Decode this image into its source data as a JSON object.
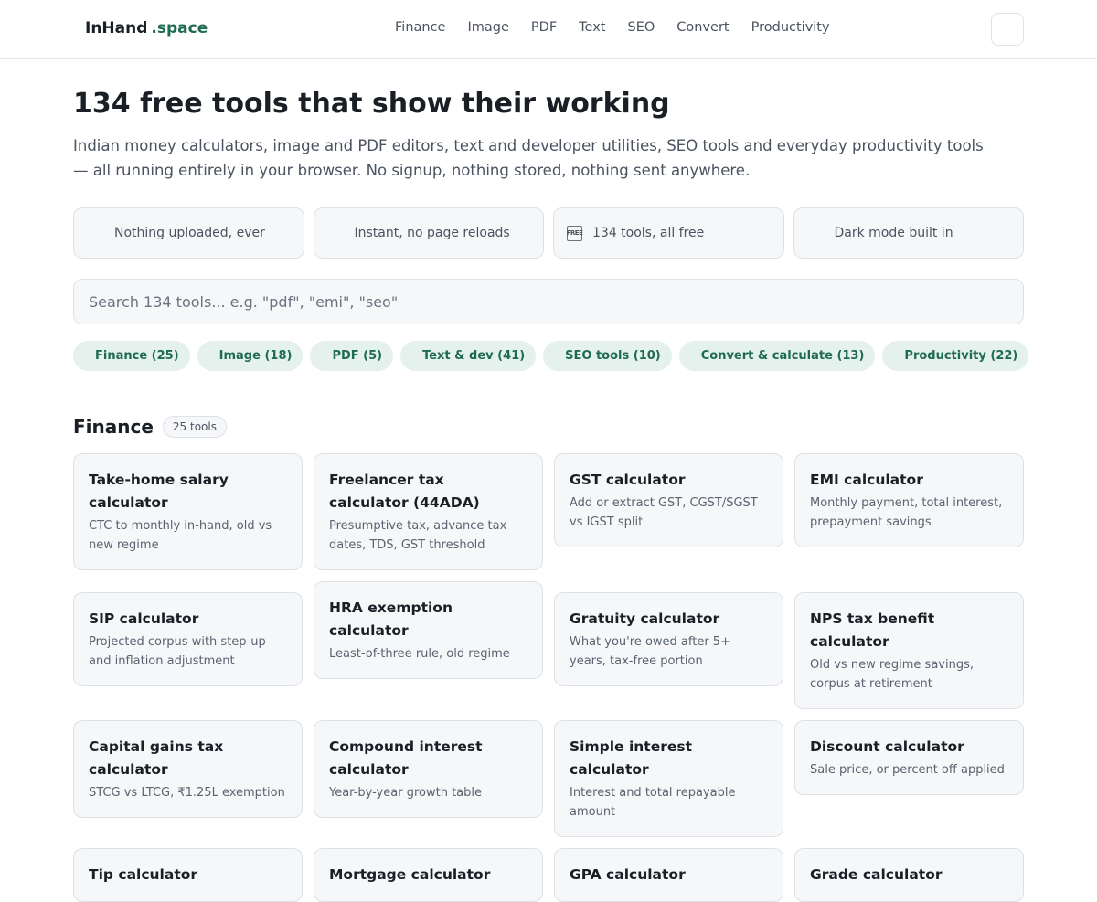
{
  "header": {
    "brand_main": "InHand",
    "brand_suffix": ".space",
    "nav": [
      "Finance",
      "Image",
      "PDF",
      "Text",
      "SEO",
      "Convert",
      "Productivity"
    ]
  },
  "hero": {
    "title": "134 free tools that show their working",
    "lede": "Indian money calculators, image and PDF editors, text and developer utilities, SEO tools and everyday productivity tools — all running entirely in your browser. No signup, nothing stored, nothing sent anywhere."
  },
  "features": [
    {
      "icon": "lock-icon",
      "label": "Nothing uploaded, ever"
    },
    {
      "icon": "lightning-icon",
      "label": "Instant, no page reloads"
    },
    {
      "icon": "free-badge-icon",
      "glyph": "FREE",
      "label": "134 tools, all free"
    },
    {
      "icon": "moon-icon",
      "label": "Dark mode built in"
    }
  ],
  "search": {
    "placeholder": "Search 134 tools... e.g. \"pdf\", \"emi\", \"seo\"",
    "value": ""
  },
  "chips": [
    "Finance (25)",
    "Image (18)",
    "PDF (5)",
    "Text & dev (41)",
    "SEO tools (10)",
    "Convert & calculate (13)",
    "Productivity (22)"
  ],
  "section": {
    "title": "Finance",
    "count": "25 tools",
    "cards": [
      {
        "title": "Take-home salary calculator",
        "desc": "CTC to monthly in-hand, old vs new regime"
      },
      {
        "title": "Freelancer tax calculator (44ADA)",
        "desc": "Presumptive tax, advance tax dates, TDS, GST threshold"
      },
      {
        "title": "GST calculator",
        "desc": "Add or extract GST, CGST/SGST vs IGST split"
      },
      {
        "title": "EMI calculator",
        "desc": "Monthly payment, total interest, prepayment savings"
      },
      {
        "title": "SIP calculator",
        "desc": "Projected corpus with step-up and inflation adjustment"
      },
      {
        "title": "HRA exemption calculator",
        "desc": "Least-of-three rule, old regime"
      },
      {
        "title": "Gratuity calculator",
        "desc": "What you're owed after 5+ years, tax-free portion"
      },
      {
        "title": "NPS tax benefit calculator",
        "desc": "Old vs new regime savings, corpus at retirement"
      },
      {
        "title": "Capital gains tax calculator",
        "desc": "STCG vs LTCG, ₹1.25L exemption"
      },
      {
        "title": "Compound interest calculator",
        "desc": "Year-by-year growth table"
      },
      {
        "title": "Simple interest calculator",
        "desc": "Interest and total repayable amount"
      },
      {
        "title": "Discount calculator",
        "desc": "Sale price, or percent off applied"
      },
      {
        "title": "Tip calculator",
        "desc": ""
      },
      {
        "title": "Mortgage calculator",
        "desc": ""
      },
      {
        "title": "GPA calculator",
        "desc": ""
      },
      {
        "title": "Grade calculator",
        "desc": ""
      }
    ]
  }
}
